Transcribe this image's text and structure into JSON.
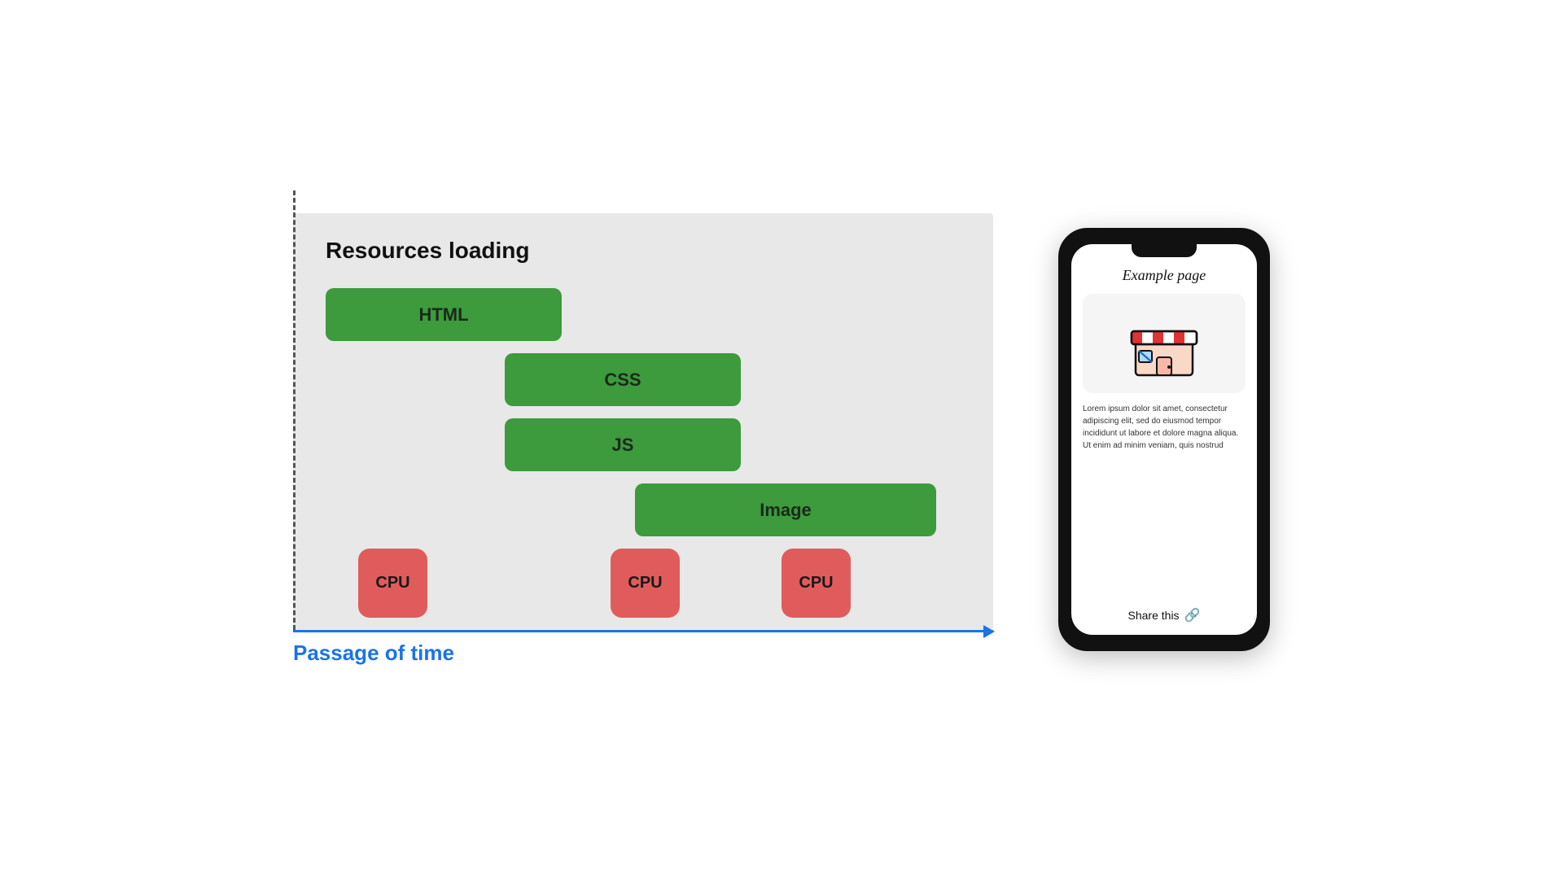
{
  "diagram": {
    "title": "Resources loading",
    "bars": [
      {
        "id": "html",
        "label": "HTML"
      },
      {
        "id": "css",
        "label": "CSS"
      },
      {
        "id": "js",
        "label": "JS"
      },
      {
        "id": "image",
        "label": "Image"
      }
    ],
    "cpu_boxes": [
      {
        "id": "cpu1",
        "label": "CPU"
      },
      {
        "id": "cpu2",
        "label": "CPU"
      },
      {
        "id": "cpu3",
        "label": "CPU"
      }
    ],
    "time_label": "Passage of time"
  },
  "phone": {
    "title": "Example page",
    "body_text": "Lorem ipsum dolor sit amet, consectetur adipiscing elit, sed do eiusmod tempor incididunt ut labore et dolore magna aliqua. Ut enim ad minim veniam, quis nostrud",
    "share_label": "Share this"
  }
}
